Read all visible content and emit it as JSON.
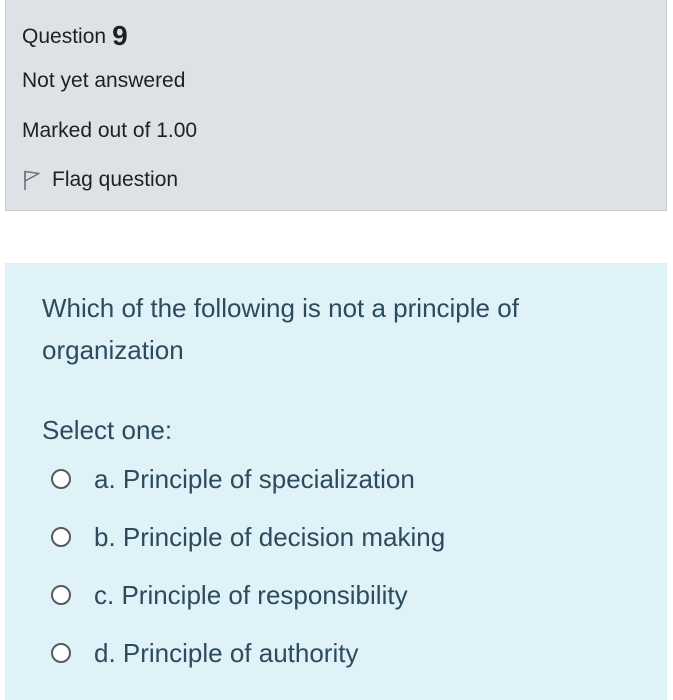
{
  "info": {
    "question_label": "Question",
    "question_number": "9",
    "state": "Not yet answered",
    "grade": "Marked out of 1.00",
    "flag_label": "Flag question",
    "flag_icon": "flag-outline-icon"
  },
  "question": {
    "text": "Which of the following is not a principle of organization",
    "prompt": "Select one:",
    "options": [
      {
        "label": "a. Principle of specialization",
        "checked": false
      },
      {
        "label": "b. Principle of decision making",
        "checked": false
      },
      {
        "label": "c. Principle of responsibility",
        "checked": false
      },
      {
        "label": "d. Principle of authority",
        "checked": false
      }
    ]
  },
  "colors": {
    "info_background": "#dee2e6",
    "content_background": "#def2f8",
    "question_text": "#2d4b5c"
  }
}
